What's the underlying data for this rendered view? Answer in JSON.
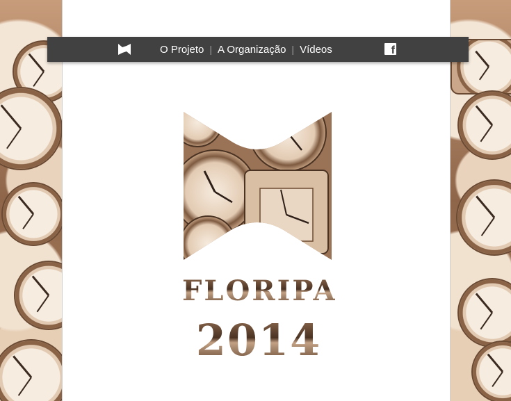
{
  "nav": {
    "links": [
      "O Projeto",
      "A Organização",
      "Vídeos"
    ],
    "logo_icon": "m-logo-icon",
    "social_icon": "facebook-icon"
  },
  "hero": {
    "title_line1": "FLORIPA",
    "title_line2": "2014"
  },
  "colors": {
    "nav_bg": "#414141",
    "nav_text": "#ffffff",
    "page_bg": "#ffffff",
    "sepia": "#8a6346"
  }
}
